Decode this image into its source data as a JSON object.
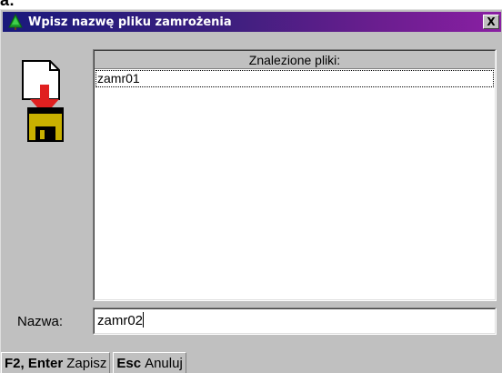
{
  "top_fragment": "a:",
  "window": {
    "title": "Wpisz nazwę pliku zamrożenia",
    "close_label": "X"
  },
  "file_list": {
    "header": "Znalezione pliki:",
    "items": [
      "zamr01"
    ]
  },
  "name_field": {
    "label": "Nazwa:",
    "value": "zamr02"
  },
  "status_bar": [
    {
      "key": "F2, Enter",
      "action": "Zapisz"
    },
    {
      "key": "Esc",
      "action": "Anuluj"
    }
  ],
  "colors": {
    "title_gradient_start": "#1a1a7c",
    "title_gradient_end": "#8a1fa3",
    "window_bg": "#c0c0c0",
    "icon_arrow": "#e02020",
    "floppy": "#c8b000"
  },
  "icons": {
    "title_icon": "green-tree-icon",
    "file_icon": "document-to-floppy-icon"
  }
}
